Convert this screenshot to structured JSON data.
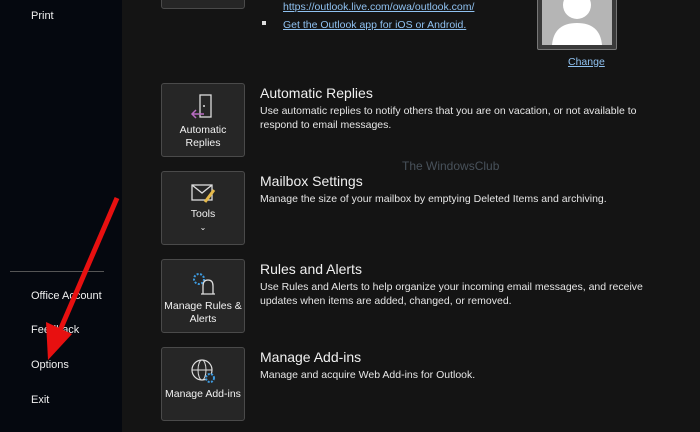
{
  "sidebar": {
    "items": [
      {
        "label": "Print"
      },
      {
        "label": "Office Account"
      },
      {
        "label": "Feedback"
      },
      {
        "label": "Options"
      },
      {
        "label": "Exit"
      }
    ]
  },
  "links": {
    "owa": "https://outlook.live.com/owa/outlook.com/",
    "app": "Get the Outlook app for iOS or Android."
  },
  "profile": {
    "change": "Change"
  },
  "sections": [
    {
      "tile": "Automatic Replies",
      "title": "Automatic Replies",
      "desc": "Use automatic replies to notify others that you are on vacation, or not available to respond to email messages."
    },
    {
      "tile": "Tools",
      "title": "Mailbox Settings",
      "desc": "Manage the size of your mailbox by emptying Deleted Items and archiving."
    },
    {
      "tile": "Manage Rules & Alerts",
      "title": "Rules and Alerts",
      "desc": "Use Rules and Alerts to help organize your incoming email messages, and receive updates when items are added, changed, or removed."
    },
    {
      "tile": "Manage Add-ins",
      "title": "Manage Add-ins",
      "desc": "Manage and acquire Web Add-ins for Outlook."
    }
  ],
  "watermark": "The WindowsClub",
  "colors": {
    "annotation_arrow": "#e81010",
    "link": "#8fc1f0"
  }
}
